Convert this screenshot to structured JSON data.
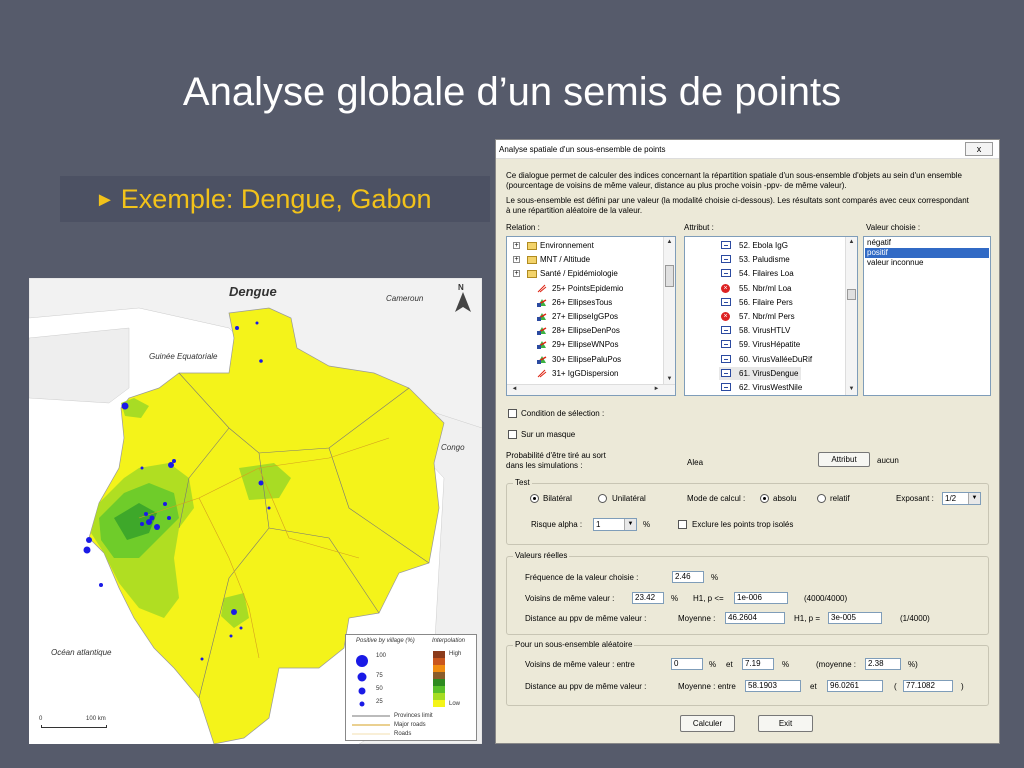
{
  "slide": {
    "title": "Analyse globale d’un semis de points",
    "bullet": "Exemple: Dengue, Gabon",
    "bullet_color": "#f2c21a"
  },
  "map": {
    "title": "Dengue",
    "labels": {
      "cameroun": "Cameroun",
      "guinee": "Guinée Equatoriale",
      "congo": "Congo",
      "ocean": "Océan atlantique"
    },
    "north": "N",
    "legend": {
      "positive_title": "Positive by village (%)",
      "interp_title": "Interpolation",
      "sizes": [
        "100",
        "75",
        "50",
        "25"
      ],
      "high": "High",
      "low": "Low",
      "lines": [
        "Provinces limit",
        "Major roads",
        "Roads"
      ],
      "ramp_colors": [
        "#8b3a1a",
        "#c9561d",
        "#f08c10",
        "#8a5c2a",
        "#2e8b20",
        "#59c02a",
        "#a5dd22",
        "#f4f418"
      ]
    },
    "scale": [
      "0",
      "100 km"
    ]
  },
  "dialog": {
    "title": "Analyse spatiale d'un sous-ensemble de points",
    "close": "x",
    "intro": [
      "Ce dialogue permet de calculer des indices concernant la répartition spatiale d'un sous-ensemble d'objets au sein d'un ensemble",
      "(pourcentage de voisins de même valeur, distance au plus proche voisin -ppv- de même valeur).",
      "Le sous-ensemble est défini par une valeur (la modalité choisie ci-dessous). Les résultats sont comparés avec ceux correspondant",
      "à une répartition aléatoire de la valeur."
    ],
    "relation_label": "Relation :",
    "attribut_label": "Attribut :",
    "valeur_label": "Valeur choisie :",
    "relation_items": [
      {
        "label": "Environnement",
        "icon": "folder"
      },
      {
        "label": "MNT / Altitude",
        "icon": "folder"
      },
      {
        "label": "Santé / Epidémiologie",
        "icon": "folder"
      },
      {
        "label": "25+ PointsEpidemio",
        "icon": "points"
      },
      {
        "label": "26+ EllipsesTous",
        "icon": "layer"
      },
      {
        "label": "27+ EllipseIgGPos",
        "icon": "layer"
      },
      {
        "label": "28+ EllipseDenPos",
        "icon": "layer"
      },
      {
        "label": "29+ EllipseWNPos",
        "icon": "layer"
      },
      {
        "label": "30+ EllipsePaluPos",
        "icon": "layer"
      },
      {
        "label": "31+ IgGDispersion",
        "icon": "points"
      }
    ],
    "attribut_items": [
      {
        "label": "52. Ebola IgG",
        "icon": "table"
      },
      {
        "label": "53. Paludisme",
        "icon": "table"
      },
      {
        "label": "54. Filaires Loa",
        "icon": "table"
      },
      {
        "label": "55. Nbr/ml Loa",
        "icon": "error"
      },
      {
        "label": "56. Filaire Pers",
        "icon": "table"
      },
      {
        "label": "57. Nbr/ml Pers",
        "icon": "error"
      },
      {
        "label": "58. VirusHTLV",
        "icon": "table"
      },
      {
        "label": "59. VirusHépatite",
        "icon": "table"
      },
      {
        "label": "60. VirusValléeDuRif",
        "icon": "table"
      },
      {
        "label": "61. VirusDengue",
        "icon": "table"
      },
      {
        "label": "62. VirusWestNile",
        "icon": "table"
      }
    ],
    "attribut_selected_index": 9,
    "valeur_items": [
      "négatif",
      "positif",
      "valeur inconnue"
    ],
    "valeur_selected_index": 1,
    "condition_selection": "Condition de sélection :",
    "sur_masque": "Sur un masque",
    "proba_line1": "Probabilité d'être tiré au sort",
    "proba_line2": "dans les simulations :",
    "alea": "Alea",
    "attribut_button": "Attribut",
    "aucun": "aucun",
    "test": {
      "title": "Test",
      "bilateral": "Bilatéral",
      "unilateral": "Unilatéral",
      "mode_label": "Mode de calcul :",
      "absolu": "absolu",
      "relatif": "relatif",
      "exposant_label": "Exposant :",
      "exposant_value": "1/2",
      "risque_label": "Risque alpha :",
      "risque_value": "1",
      "percent": "%",
      "exclure": "Exclure les points trop isolés"
    },
    "reelles": {
      "title": "Valeurs réelles",
      "freq_label": "Fréquence de la valeur choisie :",
      "freq_value": "2.46",
      "percent": "%",
      "voisins_label": "Voisins de même valeur :",
      "voisins_value": "23.42",
      "h1_le": "H1, p <=",
      "p_value": "1e-006",
      "ratio1": "(4000/4000)",
      "dist_label": "Distance au ppv de même valeur :",
      "moyenne_label": "Moyenne :",
      "moyenne_value": "46.2604",
      "h1_eq": "H1, p =",
      "p2_value": "3e-005",
      "ratio2": "(1/4000)"
    },
    "aleatoire": {
      "title": "Pour un sous-ensemble aléatoire",
      "voisins_label": "Voisins de même valeur : entre",
      "v_min": "0",
      "percent": "%",
      "et": "et",
      "v_max": "7.19",
      "moy_open": "(moyenne :",
      "v_moy": "2.38",
      "moy_close": "%)",
      "dist_label": "Distance au ppv de même valeur :",
      "moy_entre": "Moyenne : entre",
      "d_min": "58.1903",
      "d_max": "96.0261",
      "paren_open": "(",
      "d_moy": "77.1082",
      "paren_close": ")"
    },
    "calculer": "Calculer",
    "exit": "Exit"
  }
}
